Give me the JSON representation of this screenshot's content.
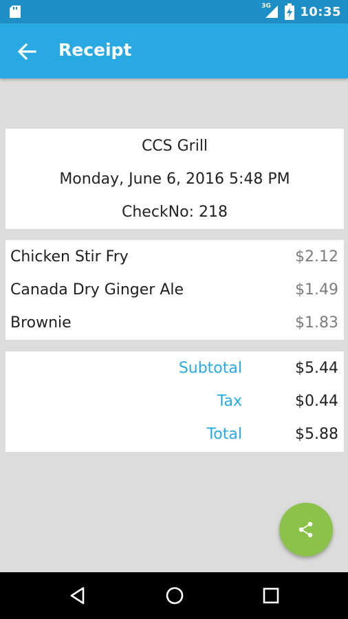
{
  "status_bar": {
    "network": "3G",
    "time": "10:35",
    "icons": [
      "sd-card-icon",
      "signal-icon",
      "battery-charging-icon"
    ]
  },
  "app_bar": {
    "title": "Receipt",
    "back_icon": "arrow-back-icon"
  },
  "receipt": {
    "restaurant": "CCS Grill",
    "datetime": "Monday, June 6, 2016 5:48 PM",
    "check_no": "CheckNo: 218"
  },
  "items": [
    {
      "name": "Chicken Stir Fry",
      "price": "$2.12"
    },
    {
      "name": "Canada Dry Ginger Ale",
      "price": "$1.49"
    },
    {
      "name": "Brownie",
      "price": "$1.83"
    }
  ],
  "totals": [
    {
      "label": "Subtotal",
      "value": "$5.44"
    },
    {
      "label": "Tax",
      "value": "$0.44"
    },
    {
      "label": "Total",
      "value": "$5.88"
    }
  ],
  "fab": {
    "icon": "share-icon"
  },
  "nav_bar": {
    "icons": [
      "nav-back-icon",
      "nav-home-icon",
      "nav-recents-icon"
    ]
  },
  "colors": {
    "status_bar": "#1e8fc6",
    "app_bar": "#29a9e1",
    "accent_label": "#29a9e1",
    "fab": "#8bc34a",
    "background": "#dcdcdc"
  }
}
